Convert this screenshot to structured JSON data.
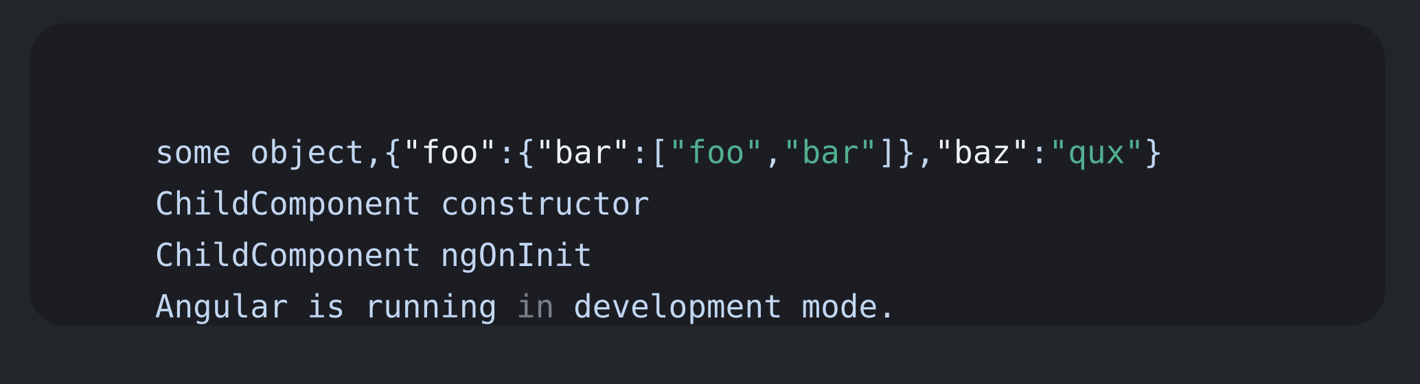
{
  "console": {
    "lines": [
      [
        {
          "t": "some object,{",
          "c": "b"
        },
        {
          "t": "\"foo\"",
          "c": "w"
        },
        {
          "t": ":{",
          "c": "b"
        },
        {
          "t": "\"bar\"",
          "c": "w"
        },
        {
          "t": ":[",
          "c": "b"
        },
        {
          "t": "\"foo\"",
          "c": "g"
        },
        {
          "t": ",",
          "c": "b"
        },
        {
          "t": "\"bar\"",
          "c": "g"
        },
        {
          "t": "]},",
          "c": "b"
        },
        {
          "t": "\"baz\"",
          "c": "w"
        },
        {
          "t": ":",
          "c": "b"
        },
        {
          "t": "\"qux\"",
          "c": "g"
        },
        {
          "t": "}",
          "c": "b"
        }
      ],
      [
        {
          "t": "ChildComponent constructor",
          "c": "b"
        }
      ],
      [
        {
          "t": "ChildComponent ngOnInit",
          "c": "b"
        }
      ],
      [
        {
          "t": "Angular is running ",
          "c": "b"
        },
        {
          "t": "in",
          "c": "m"
        },
        {
          "t": " development mode.",
          "c": "b"
        }
      ]
    ]
  },
  "colors": {
    "page_background": "#222529",
    "card_background": "#1b1d23",
    "text_default": "#c2d6f1",
    "json_key": "#eef2f8",
    "string_value": "#52b08e",
    "keyword_muted": "#7c7f89"
  }
}
